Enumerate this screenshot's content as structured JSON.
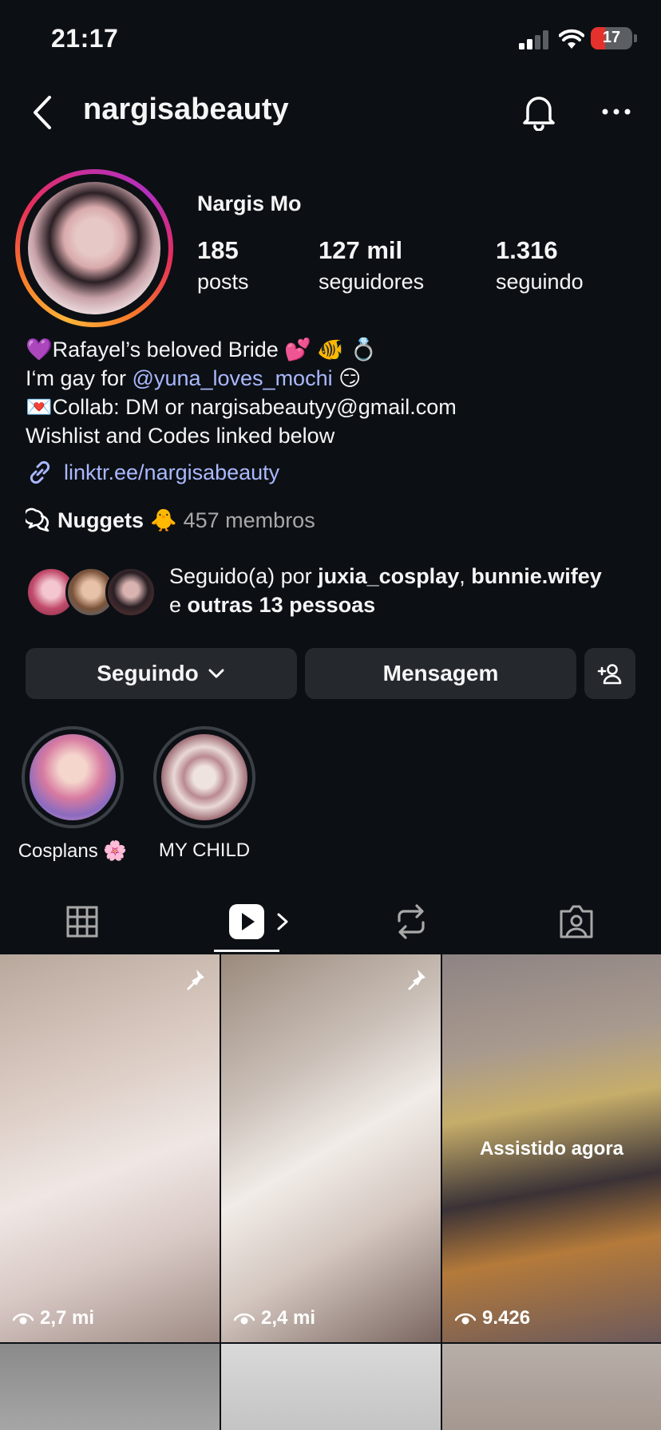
{
  "status": {
    "time": "21:17",
    "battery": "17"
  },
  "header": {
    "username": "nargisabeauty"
  },
  "profile": {
    "display_name": "Nargis Mo",
    "stats": [
      {
        "value": "185",
        "label": "posts"
      },
      {
        "value": "127 mil",
        "label": "seguidores"
      },
      {
        "value": "1.316",
        "label": "seguindo"
      }
    ],
    "bio": {
      "line1": "💜Rafayel’s beloved Bride 💕 🐠 💍",
      "line2_prefix": "I‘m gay for ",
      "line2_mention": "@yuna_loves_mochi",
      "line2_suffix": " 😏",
      "line3": "💌Collab: DM or nargisabeautyy@gmail.com",
      "line4": "Wishlist and Codes linked below"
    },
    "link": "linktr.ee/nargisabeauty",
    "channel": {
      "name": "Nuggets",
      "emoji": "🐥",
      "members": "457 membros"
    },
    "followed_by": {
      "prefix": "Seguido(a) por ",
      "user1": "juxia_cosplay",
      "separator": ", ",
      "user2": "bunnie.wifey",
      "connector": "e ",
      "others": "outras 13 pessoas"
    }
  },
  "buttons": {
    "following": "Seguindo",
    "message": "Mensagem"
  },
  "highlights": [
    {
      "label": "Cosplans 🌸"
    },
    {
      "label": "MY CHILD"
    }
  ],
  "grid": [
    {
      "views": "2,7 mi",
      "pinned": true,
      "overlay": ""
    },
    {
      "views": "2,4 mi",
      "pinned": true,
      "overlay": ""
    },
    {
      "views": "9.426",
      "pinned": false,
      "overlay": "Assistido agora"
    }
  ]
}
